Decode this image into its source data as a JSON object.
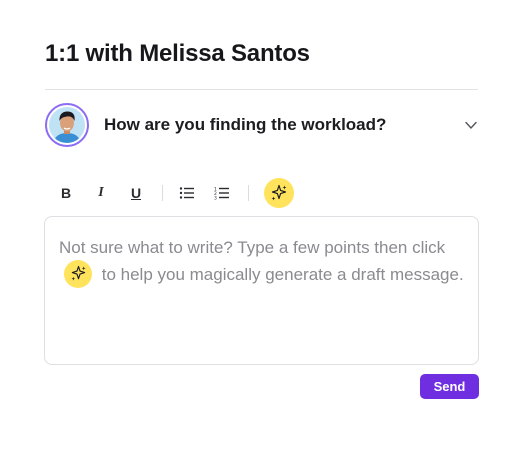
{
  "header": {
    "title": "1:1 with Melissa Santos"
  },
  "question": {
    "text": "How are you finding the workload?",
    "avatar_icon": "person-avatar",
    "toggle_icon": "chevron-down-icon"
  },
  "toolbar": {
    "bold_label": "B",
    "italic_label": "I",
    "underline_label": "U",
    "bullet_list_icon": "bullet-list-icon",
    "numbered_list_icon": "numbered-list-icon",
    "magic_icon": "sparkles-icon"
  },
  "editor": {
    "placeholder_before": "Not sure what to write? Type a few points then click",
    "placeholder_after": "to help you magically generate a draft message."
  },
  "actions": {
    "send_label": "Send"
  },
  "colors": {
    "accent": "#6f2fe0",
    "magic_yellow": "#ffe35c",
    "avatar_ring": "#8b6cf2"
  }
}
